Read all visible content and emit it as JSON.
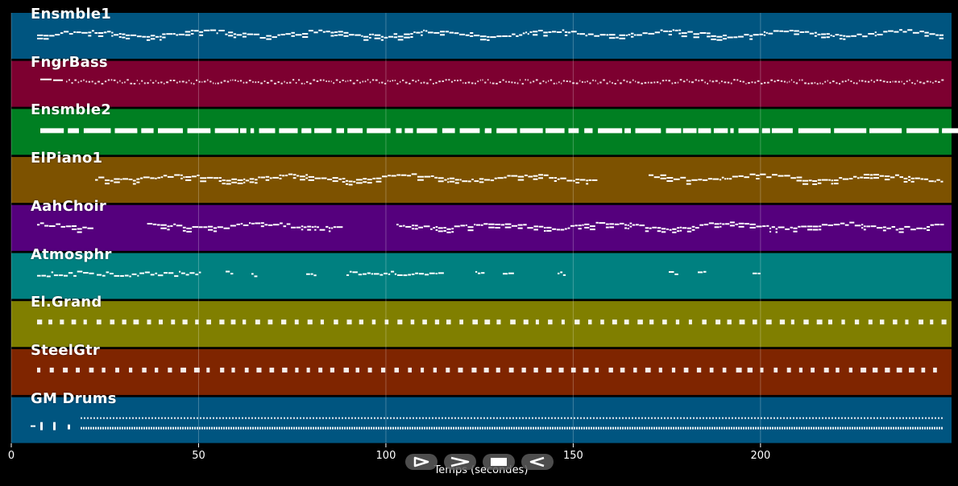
{
  "tracks": [
    {
      "name": "Ensmble1",
      "color": "#005580",
      "style": "melody"
    },
    {
      "name": "FngrBass",
      "color": "#7d0030",
      "style": "bass"
    },
    {
      "name": "Ensmble2",
      "color": "#007f22",
      "style": "block"
    },
    {
      "name": "ElPiano1",
      "color": "#7d5200",
      "style": "melody_sparse"
    },
    {
      "name": "AahChoir",
      "color": "#55007d",
      "style": "melody_gaps"
    },
    {
      "name": "Atmosphr",
      "color": "#008080",
      "style": "sparse"
    },
    {
      "name": "El.Grand",
      "color": "#807f00",
      "style": "dashes"
    },
    {
      "name": "SteelGtr",
      "color": "#7f2500",
      "style": "dashes"
    },
    {
      "name": "GM Drums",
      "color": "#005580",
      "style": "drums"
    }
  ],
  "axis": {
    "xlabel": "Temps (secondes)",
    "xlim": [
      0,
      251
    ],
    "ticks": [
      0,
      50,
      100,
      150,
      200
    ],
    "tick_labels": [
      "0",
      "50",
      "100",
      "150",
      "200"
    ]
  },
  "controls": [
    {
      "name": "play-icon"
    },
    {
      "name": "fast-forward-icon"
    },
    {
      "name": "stop-icon"
    },
    {
      "name": "rewind-icon"
    }
  ]
}
